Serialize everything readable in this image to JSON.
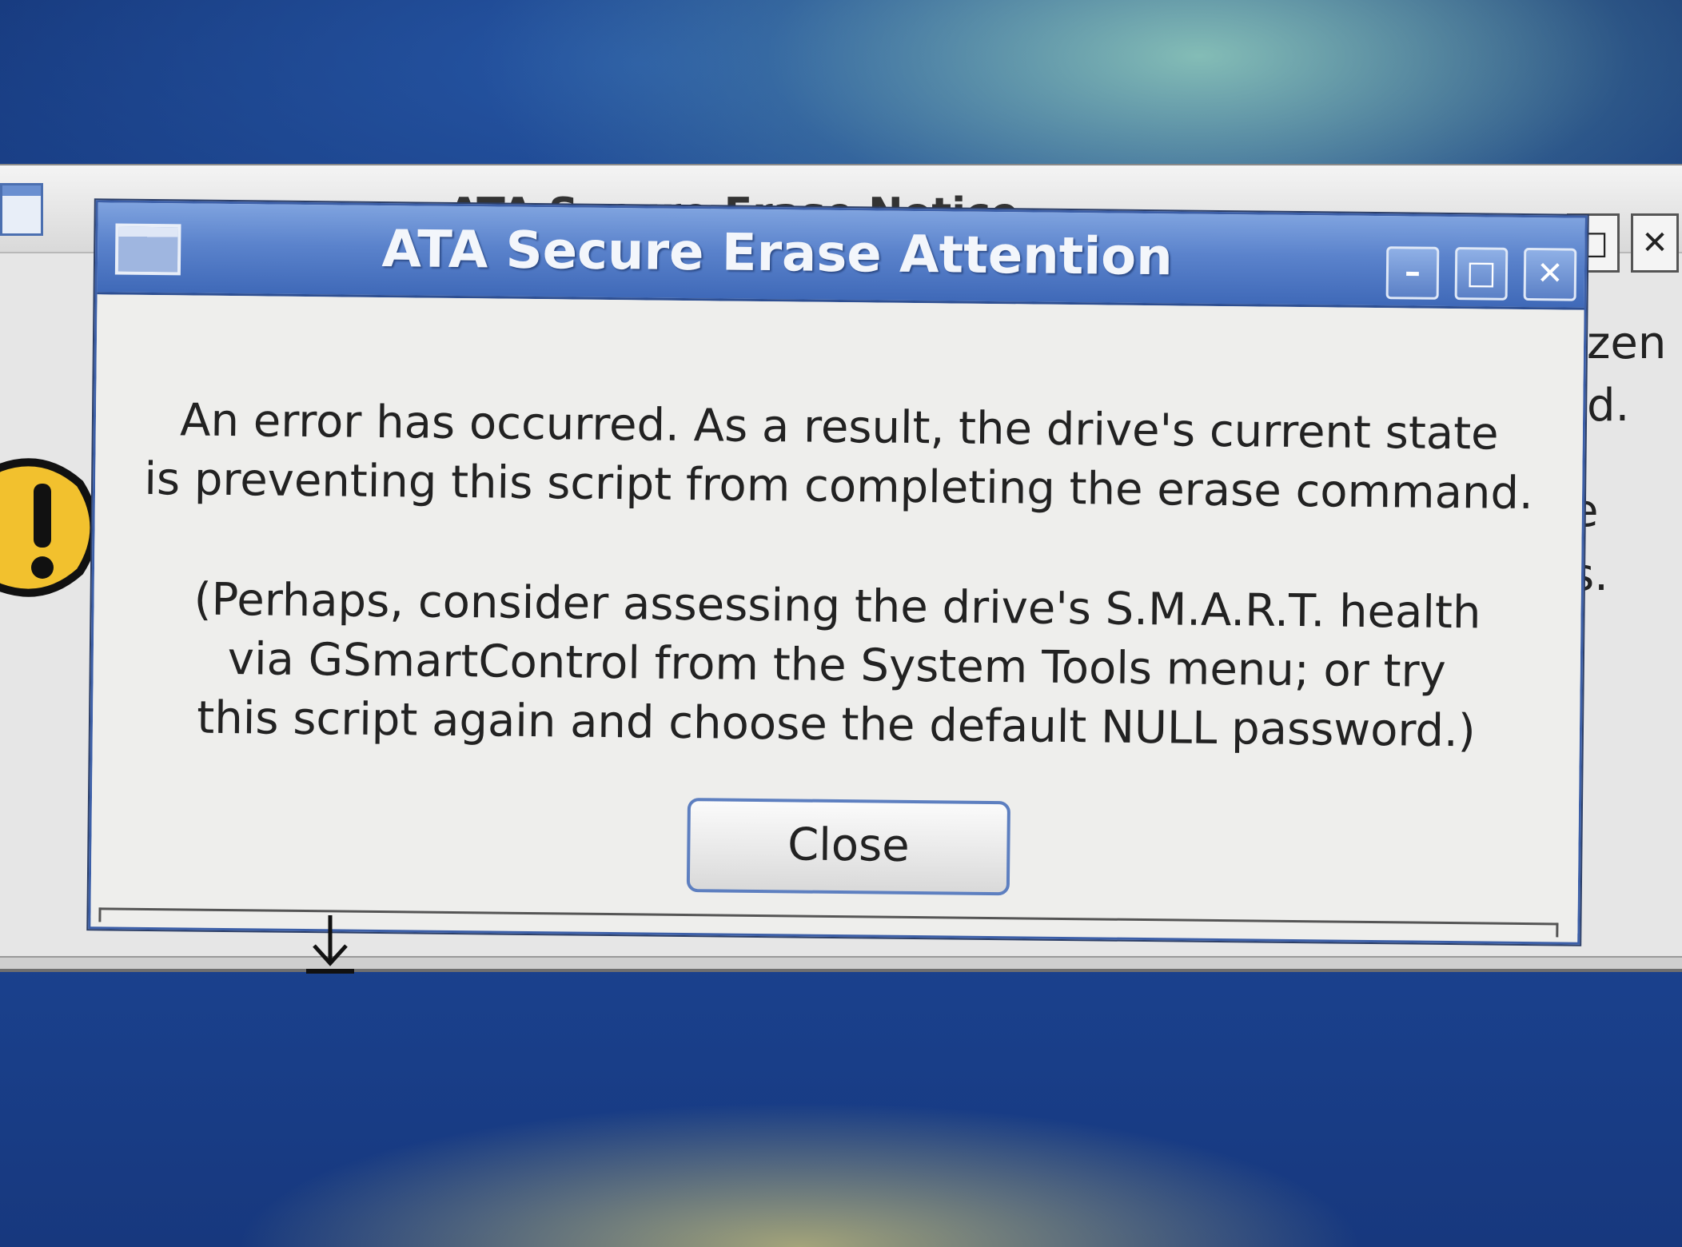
{
  "background_window": {
    "title": "ATA Secure Erase Notice",
    "controls": {
      "maximize": "□",
      "close": "✕"
    },
    "text_fragments": [
      "zen",
      "d.",
      "e",
      "s."
    ],
    "icon": "warning-icon"
  },
  "dialog": {
    "title": "ATA Secure Erase Attention",
    "window_icon": "window-icon",
    "controls": {
      "minimize": "–",
      "maximize": "□",
      "close": "✕"
    },
    "message_lines": [
      "An error has occurred. As a result, the drive's current state",
      "is preventing this script from completing the erase command."
    ],
    "hint_lines": [
      "(Perhaps, consider assessing the drive's S.M.A.R.T. health",
      "via GSmartControl from the System Tools menu; or try",
      "this script again and choose the default NULL password.)"
    ],
    "close_button": "Close"
  },
  "cursor": "resize-cursor-icon",
  "colors": {
    "titlebar": "#5b83cc",
    "dialog_bg": "#eeeeec",
    "button_border": "#5d7fc0",
    "desktop": "#1d4a9c"
  }
}
